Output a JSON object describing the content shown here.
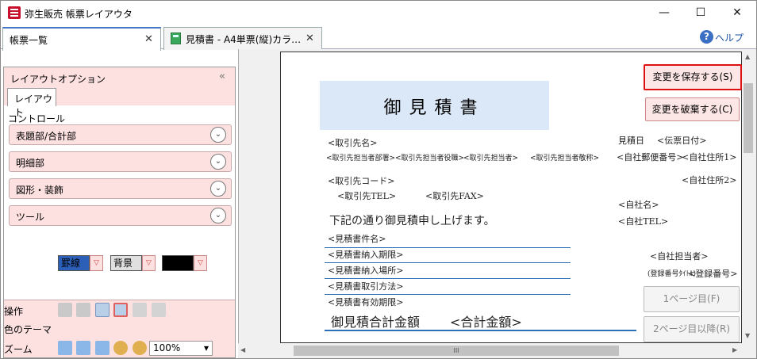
{
  "window": {
    "title": "弥生販売 帳票レイアウタ",
    "minimize": "—",
    "maximize": "☐",
    "close": "✕"
  },
  "tabs": [
    {
      "label": "帳票一覧",
      "close": "✕"
    },
    {
      "label": "見積書 - A4単票(縦)カラ…",
      "close": "✕"
    }
  ],
  "help": {
    "icon": "?",
    "label": "ヘルプ"
  },
  "left_panel": {
    "title": "レイアウトオプション",
    "collapse": "«",
    "subtab": "レイアウト",
    "controls_label": "コントロール",
    "sections": [
      "表題部/合計部",
      "明細部",
      "図形・装飾",
      "ツール"
    ],
    "chevron": "⌄",
    "operations_label": "操作",
    "color_theme_label": "色のテーマ",
    "border_label": "罫線",
    "background_label": "背景",
    "zoom_label": "ズーム",
    "zoom_value": "100%",
    "dropdown_arrow": "▽",
    "zoom_arrow": "▾"
  },
  "document": {
    "title": "御見積書",
    "client_name": "<取引先名>",
    "client_contacts": [
      "<取引先担当者部署>",
      "<取引先担当者役職>",
      "<取引先担当者>",
      "<取引先担当者敬称>"
    ],
    "client_code": "<取引先コード>",
    "client_tel": "<取引先TEL>",
    "client_fax": "<取引先FAX>",
    "intro": "下記の通り御見積申し上げます。",
    "fields": [
      "<見積書件名>",
      "<見積書納入期限>",
      "<見積書納入場所>",
      "<見積書取引方法>",
      "<見積書有効期限>"
    ],
    "total_label": "御見積合計金額",
    "total_value": "<合計金額>",
    "estimate_date_label": "見積日",
    "estimate_date_value": "<伝票日付>",
    "company_postal": "<自社郵便番号>",
    "company_addr1": "<自社住所1>",
    "company_addr2": "<自社住所2>",
    "company_name": "<自社名>",
    "company_tel": "<自社TEL>",
    "company_staff": "<自社担当者>",
    "registration_prefix": "(登録番号ﾀｲﾄﾙ)",
    "registration_number": "<登録番号>"
  },
  "buttons": {
    "save": "変更を保存する(S)",
    "discard": "変更を破棄する(C)",
    "page1": "1ページ目(F)",
    "page2": "2ページ目以降(R)"
  },
  "scroll": {
    "grip": "III",
    "left": "◀",
    "right": "▶",
    "up": "▲",
    "down": "▼"
  }
}
